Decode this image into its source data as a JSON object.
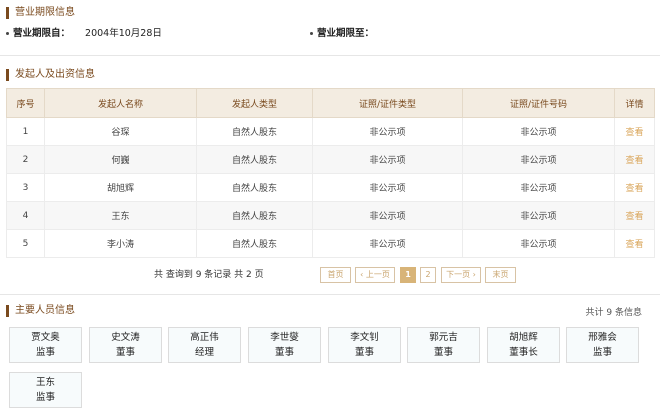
{
  "business_period": {
    "title": "营业期限信息",
    "from_label": "营业期限自：",
    "from_value": "2004年10月28日",
    "to_label": "营业期限至："
  },
  "investors": {
    "title": "发起人及出资信息",
    "columns": [
      "序号",
      "发起人名称",
      "发起人类型",
      "证照/证件类型",
      "证照/证件号码",
      "详情"
    ],
    "rows": [
      [
        "1",
        "谷琛",
        "自然人股东",
        "非公示项",
        "非公示项",
        "查看"
      ],
      [
        "2",
        "何巍",
        "自然人股东",
        "非公示项",
        "非公示项",
        "查看"
      ],
      [
        "3",
        "胡旭辉",
        "自然人股东",
        "非公示项",
        "非公示项",
        "查看"
      ],
      [
        "4",
        "王东",
        "自然人股东",
        "非公示项",
        "非公示项",
        "查看"
      ],
      [
        "5",
        "李小涛",
        "自然人股东",
        "非公示项",
        "非公示项",
        "查看"
      ]
    ],
    "pager": {
      "summary": "共 查询到 9 条记录 共 2 页",
      "first": "首页",
      "prev": "‹ 上一页",
      "page1": "1",
      "page2": "2",
      "next": "下一页 ›",
      "last": "末页"
    }
  },
  "personnel": {
    "title": "主要人员信息",
    "total": "共计 9 条信息",
    "people": [
      {
        "name": "贾文奥",
        "role": "监事"
      },
      {
        "name": "史文涛",
        "role": "董事"
      },
      {
        "name": "高正伟",
        "role": "经理"
      },
      {
        "name": "李世燮",
        "role": "董事"
      },
      {
        "name": "李文钊",
        "role": "董事"
      },
      {
        "name": "郭元吉",
        "role": "董事"
      },
      {
        "name": "胡旭辉",
        "role": "董事长"
      },
      {
        "name": "邢雅会",
        "role": "监事"
      },
      {
        "name": "王东",
        "role": "监事"
      }
    ]
  }
}
